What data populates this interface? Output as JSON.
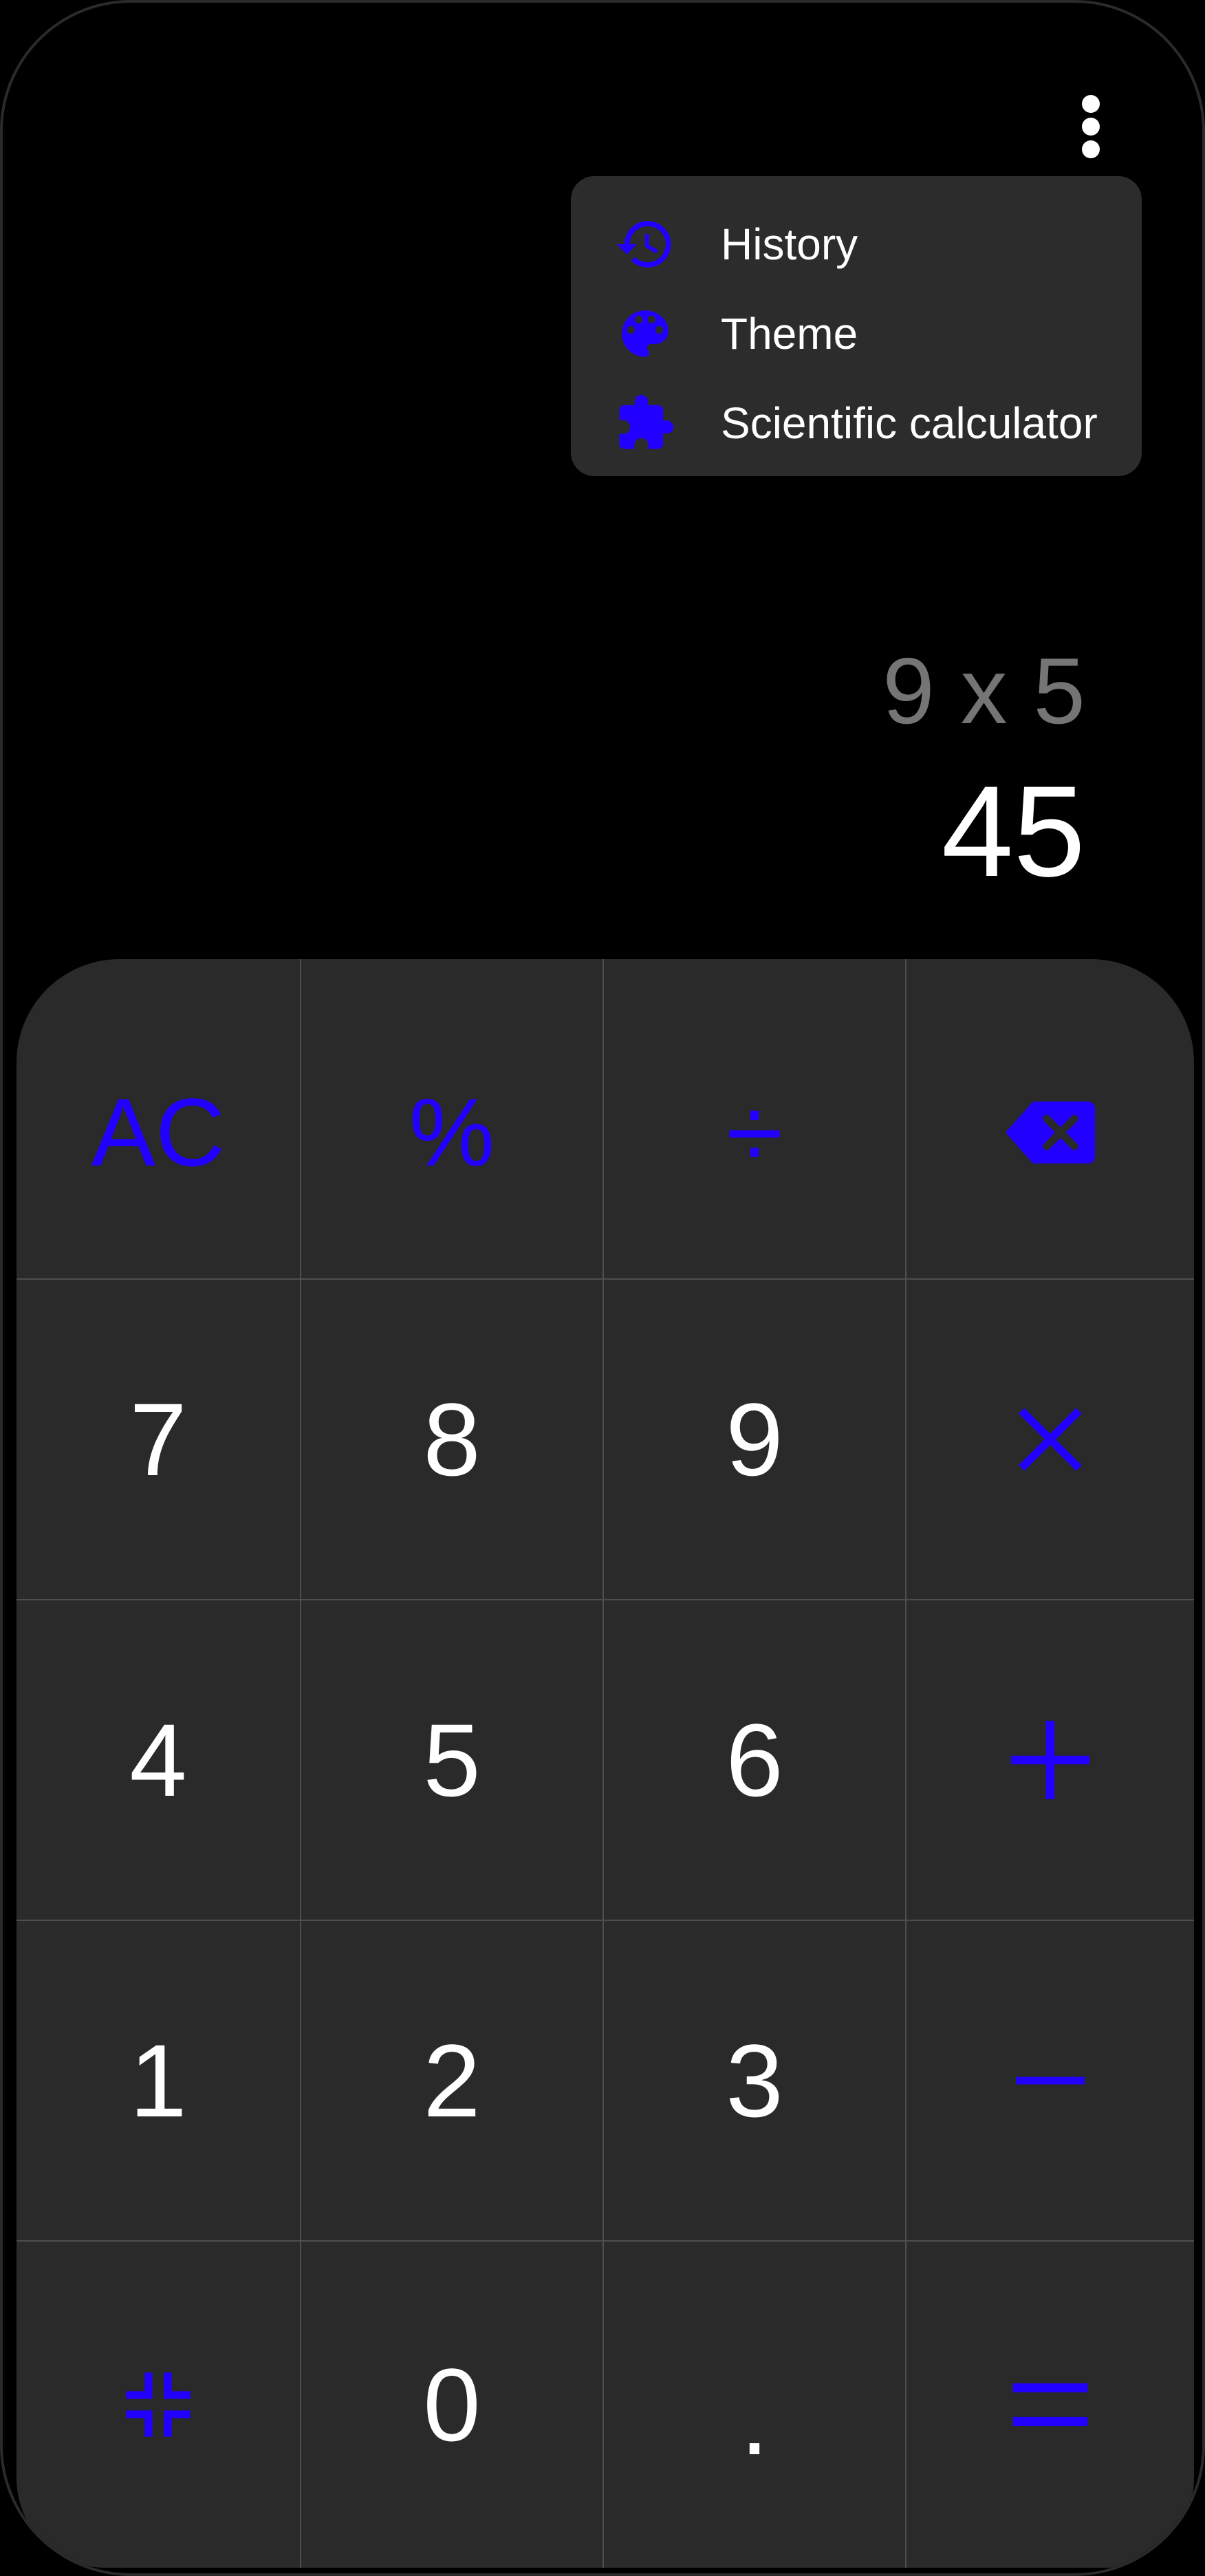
{
  "menu": {
    "items": [
      {
        "label": "History",
        "icon": "history-icon"
      },
      {
        "label": "Theme",
        "icon": "palette-icon"
      },
      {
        "label": "Scientific calculator",
        "icon": "puzzle-icon"
      }
    ]
  },
  "display": {
    "expression": "9 x 5",
    "result": "45"
  },
  "keys": {
    "clear": "AC",
    "percent": "%",
    "divide": "÷",
    "seven": "7",
    "eight": "8",
    "nine": "9",
    "four": "4",
    "five": "5",
    "six": "6",
    "one": "1",
    "two": "2",
    "three": "3",
    "zero": "0",
    "decimal": "."
  },
  "icons": {
    "backspace": "backspace-icon",
    "multiply": "multiply-icon",
    "plus": "plus-icon",
    "minus": "minus-icon",
    "equals": "equals-icon",
    "collapse": "collapse-icon",
    "more": "more-vertical-icon"
  },
  "colors": {
    "accent": "#2200ff",
    "background": "#000000",
    "keypad": "#2a2a2a",
    "menu": "#2c2c2c",
    "expression": "#757575",
    "text": "#ffffff"
  }
}
